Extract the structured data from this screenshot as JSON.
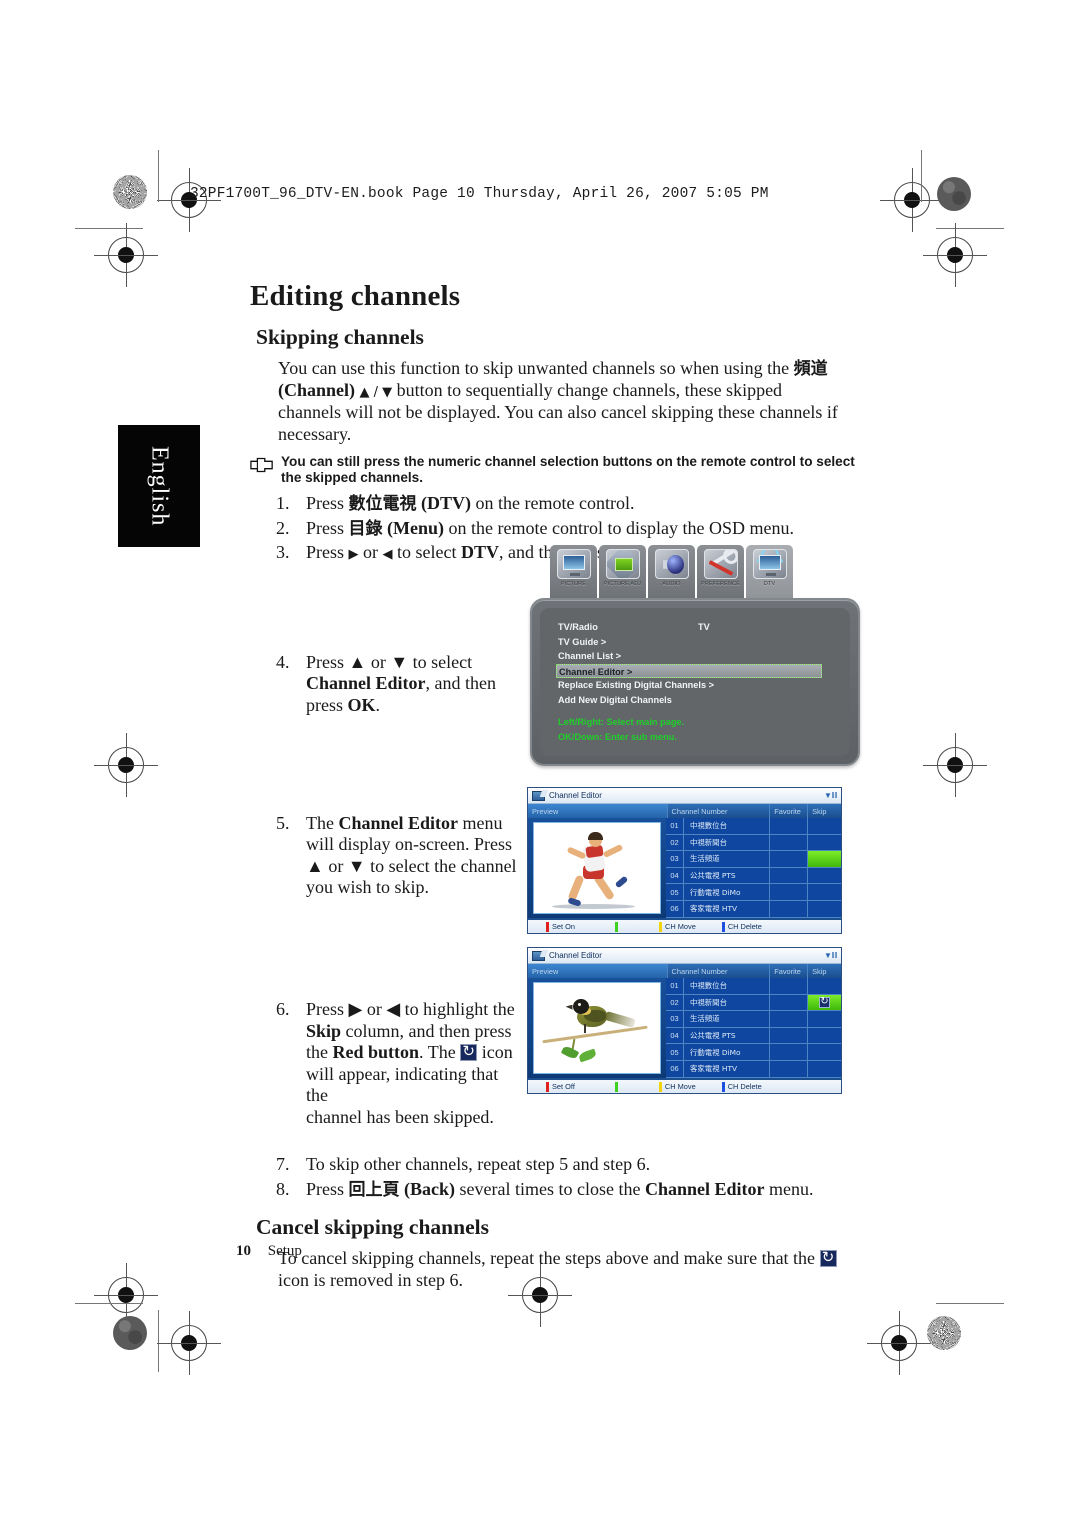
{
  "book_header": "32PF1700T_96_DTV-EN.book  Page 10  Thursday, April 26, 2007  5:05 PM",
  "language_tab": "English",
  "page": {
    "title": "Editing channels",
    "section1_title": "Skipping channels",
    "intro": {
      "line1_a": "You can use this function to skip unwanted channels so when using the ",
      "line1_cjk": "頻道",
      "line2_bold": "(Channel)",
      "line2_arrows": "▲ / ▼",
      "line2_b": " button to sequentially change channels, these skipped",
      "line3": "channels will not be displayed. You can also cancel skipping these channels if",
      "line4": "necessary."
    },
    "note": "You can still press the numeric channel selection buttons on the remote control to select the skipped channels.",
    "steps": [
      {
        "num": "1.",
        "parts": [
          {
            "t": "Press ",
            "style": "normal"
          },
          {
            "t": "數位電視",
            "style": "cjk"
          },
          {
            "t": " (DTV)",
            "style": "bold"
          },
          {
            "t": " on the remote control.",
            "style": "normal"
          }
        ]
      },
      {
        "num": "2.",
        "parts": [
          {
            "t": "Press ",
            "style": "normal"
          },
          {
            "t": "目錄",
            "style": "cjk"
          },
          {
            "t": " (Menu)",
            "style": "bold"
          },
          {
            "t": " on the remote control to display the OSD menu.",
            "style": "normal"
          }
        ]
      },
      {
        "num": "3.",
        "parts": [
          {
            "t": "Press ",
            "style": "normal"
          },
          {
            "t": "▶",
            "style": "arrow"
          },
          {
            "t": " or ",
            "style": "normal"
          },
          {
            "t": "◀",
            "style": "arrow"
          },
          {
            "t": " to select ",
            "style": "normal"
          },
          {
            "t": "DTV",
            "style": "bold"
          },
          {
            "t": ", and then press ",
            "style": "normal"
          },
          {
            "t": "▼",
            "style": "arrow"
          },
          {
            "t": " .",
            "style": "normal"
          }
        ]
      }
    ],
    "step4": {
      "num": "4.",
      "line1": "Press ▲ or ▼ to select",
      "line2_bold": "Channel Editor",
      "line2_rest": ", and then",
      "line3_a": "press ",
      "line3_bold": "OK",
      "line3_b": "."
    },
    "step5": {
      "num": "5.",
      "line1_a": "The ",
      "line1_bold": "Channel Editor",
      "line1_b": " menu",
      "line2": "will display on-screen. Press",
      "line3": "▲ or ▼ to select the channel",
      "line4": "you wish to skip."
    },
    "step6": {
      "num": "6.",
      "line1": "Press ▶ or ◀ to highlight the",
      "line2_bold": "Skip",
      "line2_rest": " column, and then press",
      "line3_a": "the ",
      "line3_bold": "Red button",
      "line3_b": ". The ",
      "line3_c": " icon",
      "line4": "will appear, indicating that the",
      "line5": "channel has been skipped."
    },
    "step7": {
      "num": "7.",
      "text": "To skip other channels, repeat step 5 and step 6."
    },
    "step8": {
      "num": "8.",
      "a": "Press ",
      "cjk": "回上頁",
      "b": " (Back)",
      "c": " several times to close the ",
      "d": "Channel Editor",
      "e": " menu."
    },
    "section2_title": "Cancel skipping channels",
    "cancel_text": {
      "line1": "To cancel skipping channels, repeat the steps above and make sure that the ",
      "line2": "icon is removed in step 6."
    },
    "footer": {
      "page_number": "10",
      "label": "Setup"
    }
  },
  "osd_menu": {
    "tabs": [
      {
        "label": "PICTURE",
        "icon": "tv-picture-icon",
        "active": false
      },
      {
        "label": "PICTURE ADJ",
        "icon": "picture-adjust-icon",
        "active": false
      },
      {
        "label": "AUDIO",
        "icon": "speaker-icon",
        "active": false
      },
      {
        "label": "PREFERENCE",
        "icon": "wrench-screwdriver-icon",
        "active": false
      },
      {
        "label": "DTV",
        "icon": "dtv-antenna-icon",
        "active": true
      }
    ],
    "rows": [
      {
        "label": "TV/Radio",
        "value": "TV",
        "selected": false
      },
      {
        "label": "TV Guide >",
        "value": "",
        "selected": false
      },
      {
        "label": "Channel List >",
        "value": "",
        "selected": false
      },
      {
        "label": "Channel Editor >",
        "value": "",
        "selected": true
      },
      {
        "label": "Replace Existing Digital Channels >",
        "value": "",
        "selected": false
      },
      {
        "label": "Add New Digital Channels",
        "value": "",
        "selected": false
      }
    ],
    "hints": [
      "Left/Right: Select main page.",
      "OK/Down: Enter sub menu."
    ]
  },
  "channel_editor_1": {
    "window_title": "Channel Editor",
    "signal_indicator": "▼‖‖",
    "columns": {
      "preview": "Preview",
      "channel_number": "Channel Number",
      "favorite": "Favorite",
      "skip": "Skip"
    },
    "preview_image": "running-athlete-photo",
    "rows": [
      {
        "num": "01",
        "name": "中視數位台",
        "favorite": "",
        "skip": "",
        "skip_highlight": false
      },
      {
        "num": "02",
        "name": "中視新聞台",
        "favorite": "",
        "skip": "",
        "skip_highlight": false
      },
      {
        "num": "03",
        "name": "生活頻道",
        "favorite": "",
        "skip": "",
        "skip_highlight": true
      },
      {
        "num": "04",
        "name": "公共電視 PTS",
        "favorite": "",
        "skip": "",
        "skip_highlight": false
      },
      {
        "num": "05",
        "name": "行動電視 DiMo",
        "favorite": "",
        "skip": "",
        "skip_highlight": false
      },
      {
        "num": "06",
        "name": "客家電視 HTV",
        "favorite": "",
        "skip": "",
        "skip_highlight": false
      }
    ],
    "footer_keys": [
      {
        "color": "#e02020",
        "label": "Set On"
      },
      {
        "color": "#3fd020",
        "label": ""
      },
      {
        "color": "#f2d310",
        "label": "CH Move"
      },
      {
        "color": "#2050e0",
        "label": "CH Delete"
      }
    ]
  },
  "channel_editor_2": {
    "window_title": "Channel Editor",
    "signal_indicator": "▼‖‖",
    "columns": {
      "preview": "Preview",
      "channel_number": "Channel Number",
      "favorite": "Favorite",
      "skip": "Skip"
    },
    "preview_image": "perched-bird-photo",
    "rows": [
      {
        "num": "01",
        "name": "中視數位台",
        "favorite": "",
        "skip": "",
        "skip_highlight": false,
        "skip_icon": false
      },
      {
        "num": "02",
        "name": "中視新聞台",
        "favorite": "",
        "skip": "",
        "skip_highlight": true,
        "skip_icon": true
      },
      {
        "num": "03",
        "name": "生活頻道",
        "favorite": "",
        "skip": "",
        "skip_highlight": false,
        "skip_icon": false
      },
      {
        "num": "04",
        "name": "公共電視 PTS",
        "favorite": "",
        "skip": "",
        "skip_highlight": false,
        "skip_icon": false
      },
      {
        "num": "05",
        "name": "行動電視 DiMo",
        "favorite": "",
        "skip": "",
        "skip_highlight": false,
        "skip_icon": false
      },
      {
        "num": "06",
        "name": "客家電視 HTV",
        "favorite": "",
        "skip": "",
        "skip_highlight": false,
        "skip_icon": false
      }
    ],
    "footer_keys": [
      {
        "color": "#e02020",
        "label": "Set Off"
      },
      {
        "color": "#3fd020",
        "label": ""
      },
      {
        "color": "#f2d310",
        "label": "CH Move"
      },
      {
        "color": "#2050e0",
        "label": "CH Delete"
      }
    ]
  },
  "colors": {
    "skip_highlight": "#5fce14",
    "osd_panel": "#626669",
    "osd_hint_green": "#1fcf2a",
    "table_blue": "#0f47a0",
    "header_blue": "#1a4e8e"
  }
}
